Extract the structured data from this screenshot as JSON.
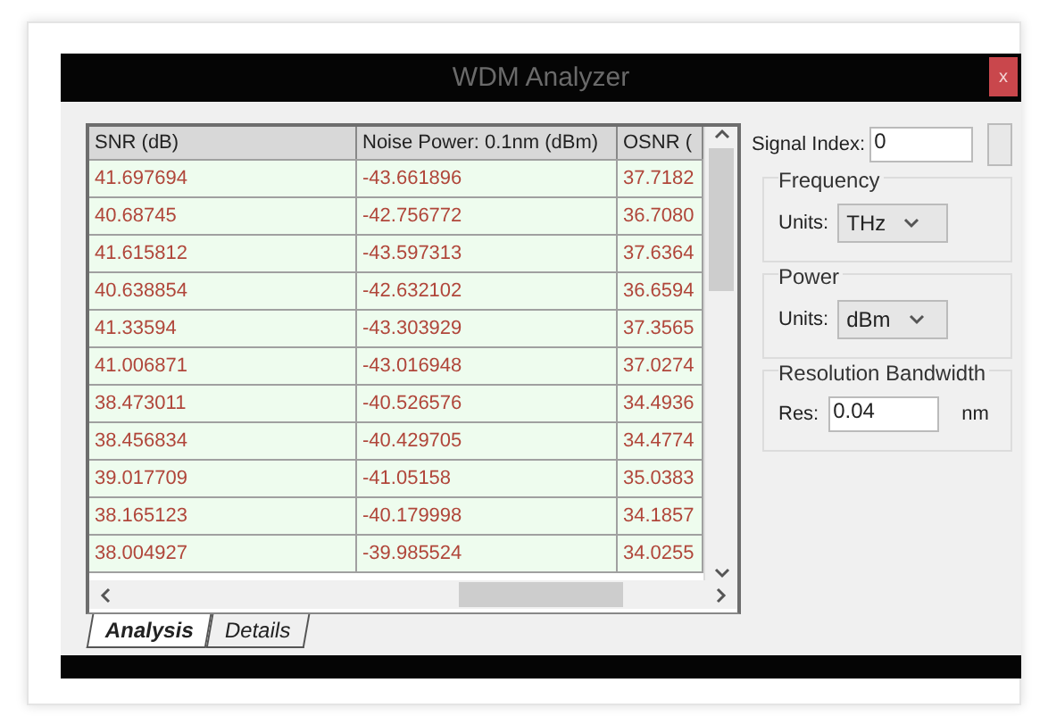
{
  "window": {
    "title": "WDM Analyzer",
    "close": "x"
  },
  "table": {
    "columns": [
      "SNR (dB)",
      "Noise Power: 0.1nm (dBm)",
      "OSNR ("
    ],
    "rows": [
      [
        "41.697694",
        "-43.661896",
        "37.7182"
      ],
      [
        "40.68745",
        "-42.756772",
        "36.7080"
      ],
      [
        "41.615812",
        "-43.597313",
        "37.6364"
      ],
      [
        "40.638854",
        "-42.632102",
        "36.6594"
      ],
      [
        "41.33594",
        "-43.303929",
        "37.3565"
      ],
      [
        "41.006871",
        "-43.016948",
        "37.0274"
      ],
      [
        "38.473011",
        "-40.526576",
        "34.4936"
      ],
      [
        "38.456834",
        "-40.429705",
        "34.4774"
      ],
      [
        "39.017709",
        "-41.05158",
        "35.0383"
      ],
      [
        "38.165123",
        "-40.179998",
        "34.1857"
      ],
      [
        "38.004927",
        "-39.985524",
        "34.0255"
      ]
    ]
  },
  "tabs": [
    {
      "label": "Analysis",
      "selected": true
    },
    {
      "label": "Details",
      "selected": false
    }
  ],
  "signal_index": {
    "label": "Signal Index:",
    "value": "0"
  },
  "groups": [
    {
      "title": "Frequency",
      "kind": "select",
      "label": "Units:",
      "value": "THz"
    },
    {
      "title": "Power",
      "kind": "select",
      "label": "Units:",
      "value": "dBm"
    },
    {
      "title": "Resolution Bandwidth",
      "kind": "input",
      "label": "Res:",
      "value": "0.04",
      "unit": "nm"
    }
  ]
}
